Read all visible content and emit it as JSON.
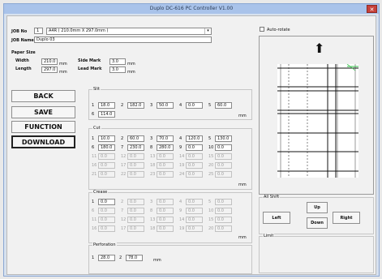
{
  "window": {
    "title": "Duplo DC-616 PC Controller V1.00",
    "close_glyph": "✕"
  },
  "job": {
    "no_label": "JOB No",
    "no_value": "1",
    "paper_combo": "A4R ( 210.0mm X 297.0mm )",
    "name_label": "JOB Name",
    "name_value": "Duplo 03"
  },
  "paper": {
    "title": "Paper Size",
    "width_label": "Width",
    "width_value": "210.0",
    "length_label": "Length",
    "length_value": "297.0",
    "unit": "mm",
    "side_mark_label": "Side Mark",
    "side_mark_value": "3.0",
    "lead_mark_label": "Lead Mark",
    "lead_mark_value": "3.0"
  },
  "buttons": {
    "back": "BACK",
    "save": "SAVE",
    "function": "FUNCTION",
    "download": "DOWNLOAD"
  },
  "slit": {
    "title": "Slit",
    "unit": "mm",
    "items": [
      {
        "n": "1",
        "v": "18.0",
        "on": true
      },
      {
        "n": "2",
        "v": "182.0",
        "on": true
      },
      {
        "n": "3",
        "v": "50.0",
        "on": true
      },
      {
        "n": "4",
        "v": "0.0",
        "on": true
      },
      {
        "n": "5",
        "v": "60.0",
        "on": true
      },
      {
        "n": "6",
        "v": "114.0",
        "on": true
      }
    ]
  },
  "cut": {
    "title": "Cut",
    "unit": "mm",
    "items": [
      {
        "n": "1",
        "v": "10.0",
        "on": true
      },
      {
        "n": "2",
        "v": "60.0",
        "on": true
      },
      {
        "n": "3",
        "v": "70.0",
        "on": true
      },
      {
        "n": "4",
        "v": "120.0",
        "on": true
      },
      {
        "n": "5",
        "v": "130.0",
        "on": true
      },
      {
        "n": "6",
        "v": "180.0",
        "on": true
      },
      {
        "n": "7",
        "v": "230.0",
        "on": true
      },
      {
        "n": "8",
        "v": "280.0",
        "on": true
      },
      {
        "n": "9",
        "v": "0.0",
        "on": true
      },
      {
        "n": "10",
        "v": "0.0",
        "on": true
      },
      {
        "n": "11",
        "v": "0.0",
        "on": false
      },
      {
        "n": "12",
        "v": "0.0",
        "on": false
      },
      {
        "n": "13",
        "v": "0.0",
        "on": false
      },
      {
        "n": "14",
        "v": "0.0",
        "on": false
      },
      {
        "n": "15",
        "v": "0.0",
        "on": false
      },
      {
        "n": "16",
        "v": "0.0",
        "on": false
      },
      {
        "n": "17",
        "v": "0.0",
        "on": false
      },
      {
        "n": "18",
        "v": "0.0",
        "on": false
      },
      {
        "n": "19",
        "v": "0.0",
        "on": false
      },
      {
        "n": "20",
        "v": "0.0",
        "on": false
      },
      {
        "n": "21",
        "v": "0.0",
        "on": false
      },
      {
        "n": "22",
        "v": "0.0",
        "on": false
      },
      {
        "n": "23",
        "v": "0.0",
        "on": false
      },
      {
        "n": "24",
        "v": "0.0",
        "on": false
      },
      {
        "n": "25",
        "v": "0.0",
        "on": false
      }
    ]
  },
  "crease": {
    "title": "Crease",
    "unit": "mm",
    "items": [
      {
        "n": "1",
        "v": "0.0",
        "on": true
      },
      {
        "n": "2",
        "v": "0.0",
        "on": false
      },
      {
        "n": "3",
        "v": "0.0",
        "on": false
      },
      {
        "n": "4",
        "v": "0.0",
        "on": false
      },
      {
        "n": "5",
        "v": "0.0",
        "on": false
      },
      {
        "n": "6",
        "v": "0.0",
        "on": false
      },
      {
        "n": "7",
        "v": "0.0",
        "on": false
      },
      {
        "n": "8",
        "v": "0.0",
        "on": false
      },
      {
        "n": "9",
        "v": "0.0",
        "on": false
      },
      {
        "n": "10",
        "v": "0.0",
        "on": false
      },
      {
        "n": "11",
        "v": "0.0",
        "on": false
      },
      {
        "n": "12",
        "v": "0.0",
        "on": false
      },
      {
        "n": "13",
        "v": "0.0",
        "on": false
      },
      {
        "n": "14",
        "v": "0.0",
        "on": false
      },
      {
        "n": "15",
        "v": "0.0",
        "on": false
      },
      {
        "n": "16",
        "v": "0.0",
        "on": false
      },
      {
        "n": "17",
        "v": "0.0",
        "on": false
      },
      {
        "n": "18",
        "v": "0.0",
        "on": false
      },
      {
        "n": "19",
        "v": "0.0",
        "on": false
      },
      {
        "n": "20",
        "v": "0.0",
        "on": false
      }
    ]
  },
  "perforation": {
    "title": "Perforation",
    "unit": "mm",
    "items": [
      {
        "n": "1",
        "v": "28.0",
        "on": true
      },
      {
        "n": "2",
        "v": "78.0",
        "on": true
      }
    ]
  },
  "preview": {
    "auto_rotate_label": "Auto-rotate",
    "arrow_glyph": "⬆"
  },
  "all_shift": {
    "title": "All Shift",
    "up": "Up",
    "left": "Left",
    "right": "Right",
    "down": "Down"
  },
  "limit": {
    "title": "Limit"
  },
  "colors": {
    "titlebar": "#a9c3ea",
    "close": "#c7413a",
    "accent_line": "#35c24a"
  }
}
